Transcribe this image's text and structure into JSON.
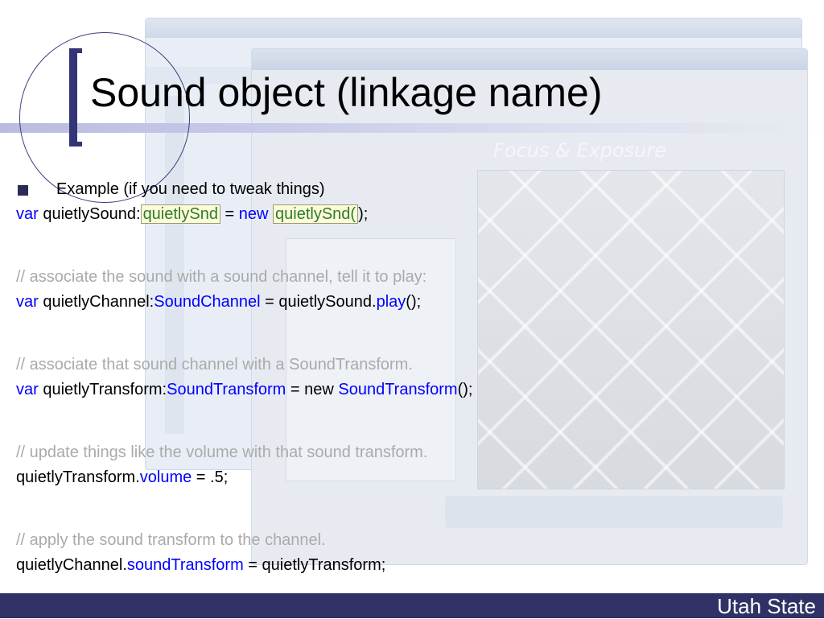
{
  "slide": {
    "title": "Sound object (linkage name)",
    "footer": "Utah State",
    "background_banner": "Focus & Exposure"
  },
  "colors": {
    "keyword": "#0000ff",
    "comment": "#aaaaaa",
    "highlight_bg": "#fcfcd8",
    "footer_bg": "#303266",
    "bracket": "#343576"
  },
  "lines": {
    "bullet": "Example (if you need to tweak things)",
    "l1": {
      "kw1": "var",
      "t1": " quietlySound:",
      "hl1": "quietlySnd",
      "t2": " = ",
      "kw2": "new",
      "t3": " ",
      "hl2": "quietlySnd(",
      "t4": ");"
    },
    "c1": "//  associate the sound with a sound channel, tell it to play:",
    "l2": {
      "kw1": "var",
      "t1": " quietlyChannel:",
      "kw2": "SoundChannel",
      "t2": " = quietlySound.",
      "kw3": "play",
      "t3": "();"
    },
    "c2": "// associate that sound channel with a SoundTransform.",
    "l3": {
      "kw1": "var",
      "t1": " quietlyTransform:",
      "kw2": "SoundTransform",
      "t2": " = new ",
      "kw3": "SoundTransform",
      "t3": "();"
    },
    "c3": "// update things like the volume with that sound transform.",
    "l4": {
      "t1": "quietlyTransform.",
      "kw1": "volume",
      "t2": " = .5;"
    },
    "c4": "// apply the sound transform to the channel.",
    "l5": {
      "t1": "quietlyChannel.",
      "kw1": "soundTransform",
      "t2": " = quietlyTransform;"
    }
  }
}
